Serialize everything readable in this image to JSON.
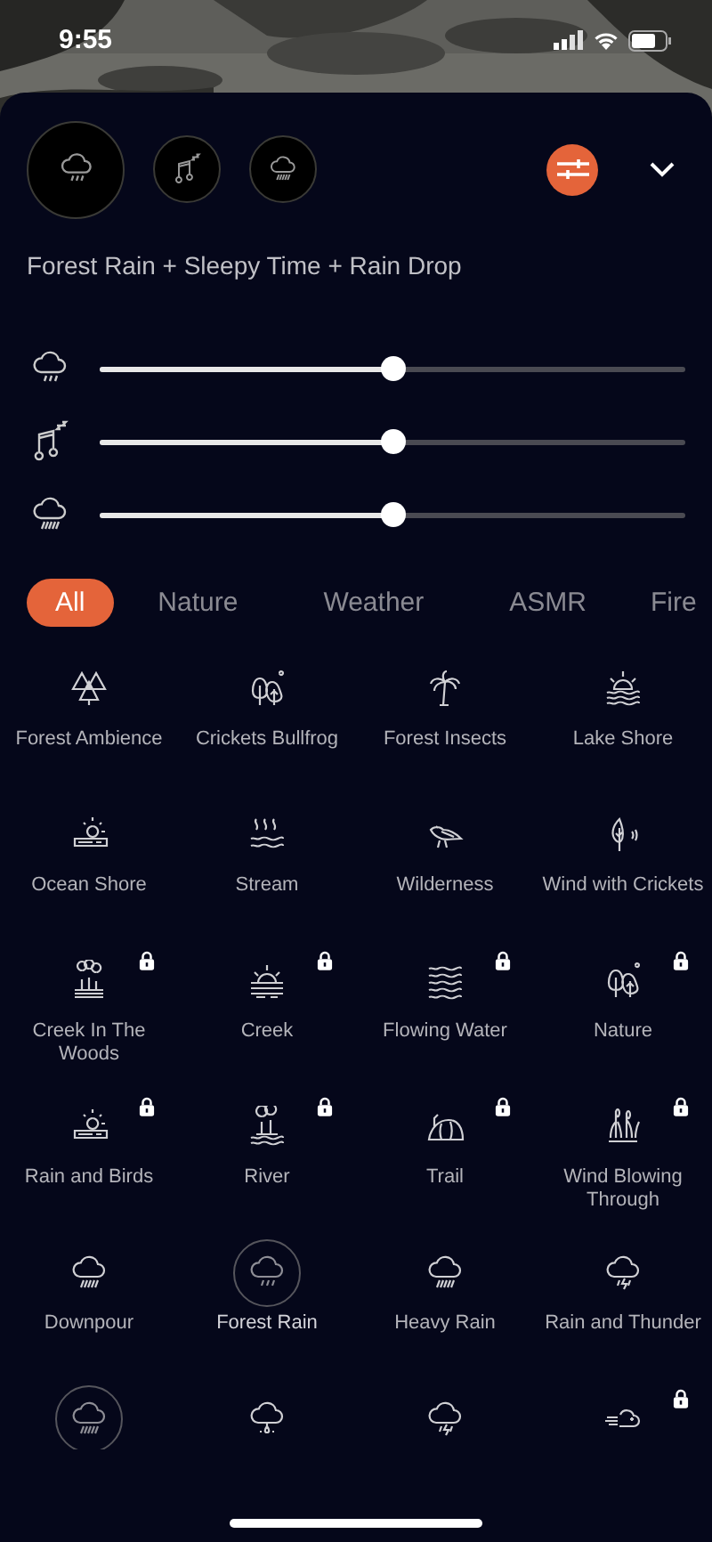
{
  "status_bar": {
    "time": "9:55"
  },
  "mixer": {
    "sounds": [
      {
        "kind": "cloud-rain",
        "selected": true
      },
      {
        "kind": "music-sleep",
        "selected": false
      },
      {
        "kind": "cloud-heavy",
        "selected": false
      }
    ],
    "title": "Forest Rain + Sleepy Time + Rain Drop",
    "sliders": [
      {
        "kind": "cloud-rain",
        "level": 0.5
      },
      {
        "kind": "music-sleep",
        "level": 0.5
      },
      {
        "kind": "cloud-heavy",
        "level": 0.5
      }
    ]
  },
  "tabs": [
    {
      "label": "All",
      "selected": true
    },
    {
      "label": "Nature",
      "selected": false
    },
    {
      "label": "Weather",
      "selected": false
    },
    {
      "label": "ASMR",
      "selected": false
    },
    {
      "label": "Fire",
      "selected": false
    }
  ],
  "sounds": [
    {
      "label": "Forest Ambience",
      "kind": "pines",
      "locked": false,
      "selected": false
    },
    {
      "label": "Crickets Bullfrog",
      "kind": "trees",
      "locked": false,
      "selected": false
    },
    {
      "label": "Forest Insects",
      "kind": "palm",
      "locked": false,
      "selected": false
    },
    {
      "label": "Lake Shore",
      "kind": "sunset",
      "locked": false,
      "selected": false
    },
    {
      "label": "Ocean Shore",
      "kind": "beach",
      "locked": false,
      "selected": false
    },
    {
      "label": "Stream",
      "kind": "stream",
      "locked": false,
      "selected": false
    },
    {
      "label": "Wilderness",
      "kind": "bird",
      "locked": false,
      "selected": false
    },
    {
      "label": "Wind with Crickets",
      "kind": "leaf",
      "locked": false,
      "selected": false
    },
    {
      "label": "Creek In The Woods",
      "kind": "grove",
      "locked": true,
      "selected": false
    },
    {
      "label": "Creek",
      "kind": "sunrise",
      "locked": true,
      "selected": false
    },
    {
      "label": "Flowing Water",
      "kind": "waves",
      "locked": true,
      "selected": false
    },
    {
      "label": "Nature",
      "kind": "trees",
      "locked": true,
      "selected": false
    },
    {
      "label": "Rain and Birds",
      "kind": "beach",
      "locked": true,
      "selected": false
    },
    {
      "label": "River",
      "kind": "island",
      "locked": true,
      "selected": false
    },
    {
      "label": "Trail",
      "kind": "hill",
      "locked": true,
      "selected": false
    },
    {
      "label": "Wind Blowing Through",
      "kind": "reeds",
      "locked": true,
      "selected": false
    },
    {
      "label": "Downpour",
      "kind": "cloud-heavy",
      "locked": false,
      "selected": false
    },
    {
      "label": "Forest Rain",
      "kind": "cloud-rain",
      "locked": false,
      "selected": true
    },
    {
      "label": "Heavy Rain",
      "kind": "cloud-heavy",
      "locked": false,
      "selected": false
    },
    {
      "label": "Rain and Thunder",
      "kind": "cloud-thunder",
      "locked": false,
      "selected": false
    },
    {
      "kind": "cloud-heavy",
      "locked": false,
      "selected": true
    },
    {
      "kind": "cloud-drop",
      "locked": false,
      "selected": false
    },
    {
      "kind": "cloud-thunder",
      "locked": false,
      "selected": false
    },
    {
      "kind": "cloud-wind",
      "locked": true,
      "selected": false
    }
  ]
}
